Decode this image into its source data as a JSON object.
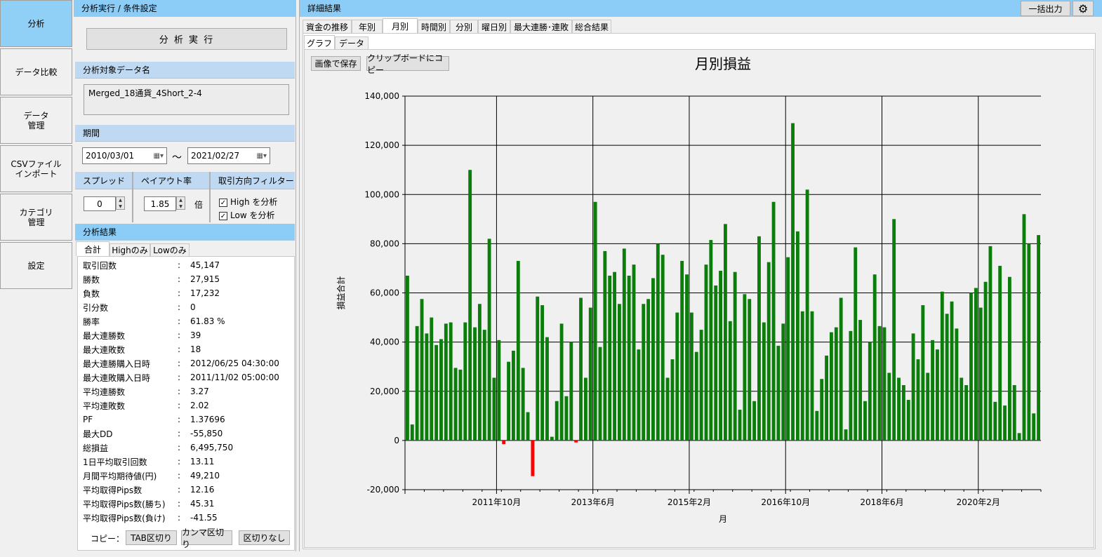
{
  "nav": [
    "分析",
    "データ比較",
    "データ\n管理",
    "CSVファイル\nインポート",
    "カテゴリ\n管理",
    "設定"
  ],
  "left": {
    "header": "分析実行 / 条件設定",
    "run_button": "分 析 実 行",
    "data_name_header": "分析対象データ名",
    "data_name_value": "Merged_18通貨_4Short_2-4",
    "period_header": "期間",
    "date_from": "2010/03/01",
    "date_to": "2021/02/27",
    "tilde": "～",
    "spread_header": "スプレッド",
    "spread_value": "0",
    "payout_header": "ペイアウト率",
    "payout_value": "1.85",
    "payout_unit": "倍",
    "filter_header": "取引方向フィルター",
    "filter_high": "High を分析",
    "filter_low": "Low を分析",
    "results_header": "分析結果",
    "result_tabs": [
      "合計",
      "Highのみ",
      "Lowのみ"
    ],
    "stats": [
      [
        "取引回数",
        "45,147"
      ],
      [
        "勝数",
        "27,915"
      ],
      [
        "負数",
        "17,232"
      ],
      [
        "引分数",
        "0"
      ],
      [
        "勝率",
        "61.83 %"
      ],
      [
        "最大連勝数",
        "39"
      ],
      [
        "最大連敗数",
        "18"
      ],
      [
        "最大連勝購入日時",
        "2012/06/25 04:30:00"
      ],
      [
        "最大連敗購入日時",
        "2011/11/02 05:00:00"
      ],
      [
        "平均連勝数",
        "3.27"
      ],
      [
        "平均連敗数",
        "2.02"
      ],
      [
        "PF",
        "1.37696"
      ],
      [
        "最大DD",
        "-55,850"
      ],
      [
        "総損益",
        "6,495,750"
      ],
      [
        "1日平均取引回数",
        "13.11"
      ],
      [
        "月間平均期待値(円)",
        "49,210"
      ],
      [
        "平均取得Pips数",
        "12.16"
      ],
      [
        "平均取得Pips数(勝ち)",
        "45.31"
      ],
      [
        "平均取得Pips数(負け)",
        "-41.55"
      ]
    ],
    "copy_label": "コピー：",
    "copy_buttons": [
      "TAB区切り",
      "カンマ区切り",
      "区切りなし"
    ]
  },
  "right": {
    "header": "詳細結果",
    "export_button": "一括出力",
    "gear_icon": "gear-icon",
    "tabs": [
      "資金の推移",
      "年別",
      "月別",
      "時間別",
      "分別",
      "曜日別",
      "最大連勝･連敗",
      "総合結果"
    ],
    "subtabs": [
      "グラフ",
      "データ"
    ],
    "save_image": "画像で保存",
    "copy_clipboard": "クリップボードにコピー"
  },
  "colors": {
    "positive": "#0a7d0a",
    "negative": "#ff0000",
    "nav_active": "#90cff6",
    "header_blue": "#8ccdf7"
  },
  "chart_data": {
    "type": "bar",
    "title": "月別損益",
    "xlabel": "月",
    "ylabel": "損益合計",
    "ylim": [
      -20000,
      140000
    ],
    "yticks": [
      "-20,000",
      "0",
      "20,000",
      "40,000",
      "60,000",
      "80,000",
      "100,000",
      "120,000",
      "140,000"
    ],
    "xticks": [
      {
        "label": "2011年10月",
        "index": 19
      },
      {
        "label": "2013年6月",
        "index": 39
      },
      {
        "label": "2015年2月",
        "index": 59
      },
      {
        "label": "2016年10月",
        "index": 79
      },
      {
        "label": "2018年6月",
        "index": 99
      },
      {
        "label": "2020年2月",
        "index": 119
      }
    ],
    "categories_start": "2010年3月",
    "categories_end": "2021年2月",
    "values": [
      67000,
      6500,
      46500,
      57500,
      43500,
      50000,
      38800,
      41200,
      47500,
      48000,
      29500,
      28800,
      48000,
      110000,
      46000,
      55500,
      45000,
      82000,
      25500,
      40800,
      -1500,
      32000,
      36500,
      73000,
      29500,
      11500,
      -14500,
      58500,
      55000,
      42000,
      1500,
      16000,
      47500,
      18000,
      40000,
      -800,
      58000,
      25500,
      54000,
      97000,
      38000,
      77000,
      67000,
      68500,
      55500,
      78000,
      67000,
      71500,
      37000,
      55500,
      57500,
      66000,
      80000,
      75500,
      25500,
      33000,
      52000,
      73000,
      67500,
      52000,
      36000,
      45000,
      71500,
      81500,
      63000,
      69000,
      88000,
      48500,
      68500,
      12500,
      59500,
      57500,
      16000,
      83000,
      48000,
      72500,
      97000,
      38500,
      47500,
      74500,
      129000,
      85000,
      52500,
      102000,
      52500,
      12000,
      25000,
      34500,
      44000,
      46000,
      58000,
      4500,
      44500,
      78500,
      49000,
      16000,
      40000,
      67500,
      46500,
      46000,
      27500,
      90000,
      25500,
      22500,
      16500,
      43500,
      33000,
      55000,
      27500,
      40800,
      37000,
      60500,
      51500,
      56500,
      45500,
      25500,
      22500,
      60000,
      62000,
      54000,
      64500,
      79000,
      15700,
      71000,
      14200,
      66500,
      22500,
      3000,
      92000,
      80000,
      11000,
      83500
    ]
  }
}
